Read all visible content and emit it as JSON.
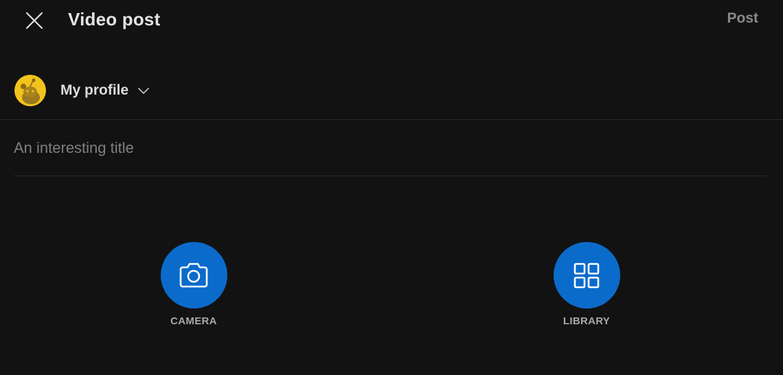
{
  "header": {
    "title": "Video post",
    "post_label": "Post"
  },
  "profile": {
    "label": "My profile"
  },
  "title_input": {
    "placeholder": "An interesting title",
    "value": ""
  },
  "actions": [
    {
      "label": "CAMERA",
      "icon": "camera-icon"
    },
    {
      "label": "LIBRARY",
      "icon": "grid-icon"
    }
  ],
  "colors": {
    "background": "#121212",
    "accent": "#0b6bcb",
    "avatar": "#f2c31c"
  }
}
